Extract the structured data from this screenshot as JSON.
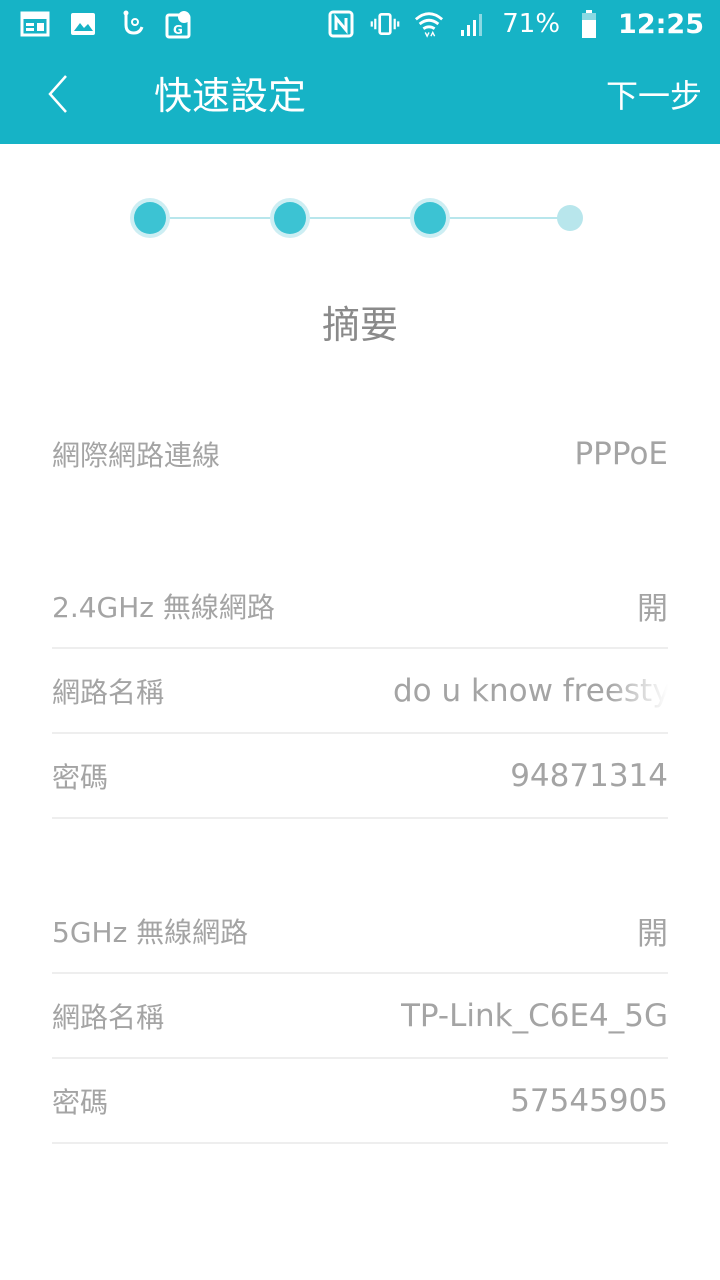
{
  "status_bar": {
    "left_icons": [
      "calendar-icon",
      "image-icon",
      "touch-icon",
      "map-pin-icon"
    ],
    "right_icons": [
      "nfc-icon",
      "vibrate-icon",
      "wifi-icon",
      "signal-icon",
      "battery-icon"
    ],
    "battery": "71%",
    "time": "12:25"
  },
  "app_bar": {
    "title": "快速設定",
    "next_label": "下一步"
  },
  "stepper": {
    "total_steps": 4,
    "completed_steps": 3
  },
  "summary": {
    "title": "摘要",
    "internet": {
      "label": "網際網路連線",
      "value": "PPPoE"
    },
    "wifi24": {
      "header": {
        "label": "2.4GHz 無線網路",
        "value": "開"
      },
      "ssid": {
        "label": "網路名稱",
        "value": "do u know freestyl"
      },
      "password": {
        "label": "密碼",
        "value": "94871314"
      }
    },
    "wifi5": {
      "header": {
        "label": "5GHz 無線網路",
        "value": "開"
      },
      "ssid": {
        "label": "網路名稱",
        "value": "TP-Link_C6E4_5G"
      },
      "password": {
        "label": "密碼",
        "value": "57545905"
      }
    }
  },
  "colors": {
    "accent": "#16b3c6",
    "step_active": "#3cc3d3",
    "step_pending": "#b8e6ec",
    "text_muted": "#a4a4a4"
  }
}
